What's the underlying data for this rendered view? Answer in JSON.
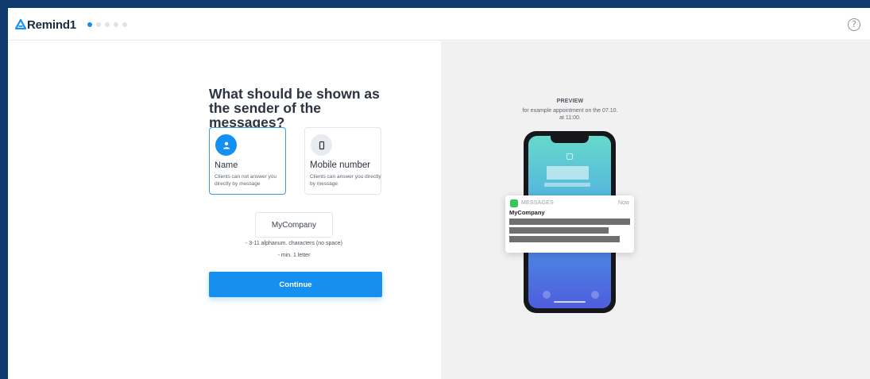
{
  "header": {
    "logo_text": "Remind1",
    "steps_total": 5,
    "step_current": 1,
    "help_label": "?"
  },
  "main": {
    "question": "What should be shown as the sender of the messages?",
    "options": [
      {
        "title": "Name",
        "description": "Clients can not answer you directly by message",
        "selected": true,
        "icon": "user-icon"
      },
      {
        "title": "Mobile number",
        "description": "Clients can answer you directly by message",
        "selected": false,
        "icon": "smartphone-icon"
      }
    ],
    "sender_input": {
      "value": "MyCompany",
      "placeholder": ""
    },
    "rules": [
      "- 3-11 alphanum. characters (no space)",
      "- min. 1 letter"
    ],
    "continue_label": "Continue"
  },
  "preview": {
    "title": "PREVIEW",
    "subtitle": "for example appointment on the 07.10. at 11:00.",
    "notification": {
      "app": "MESSAGES",
      "time": "Now",
      "sender": "MyCompany"
    }
  },
  "colors": {
    "accent": "#1590f0",
    "frame": "#0d3b6e",
    "preview_bg": "#f1f1f1"
  }
}
